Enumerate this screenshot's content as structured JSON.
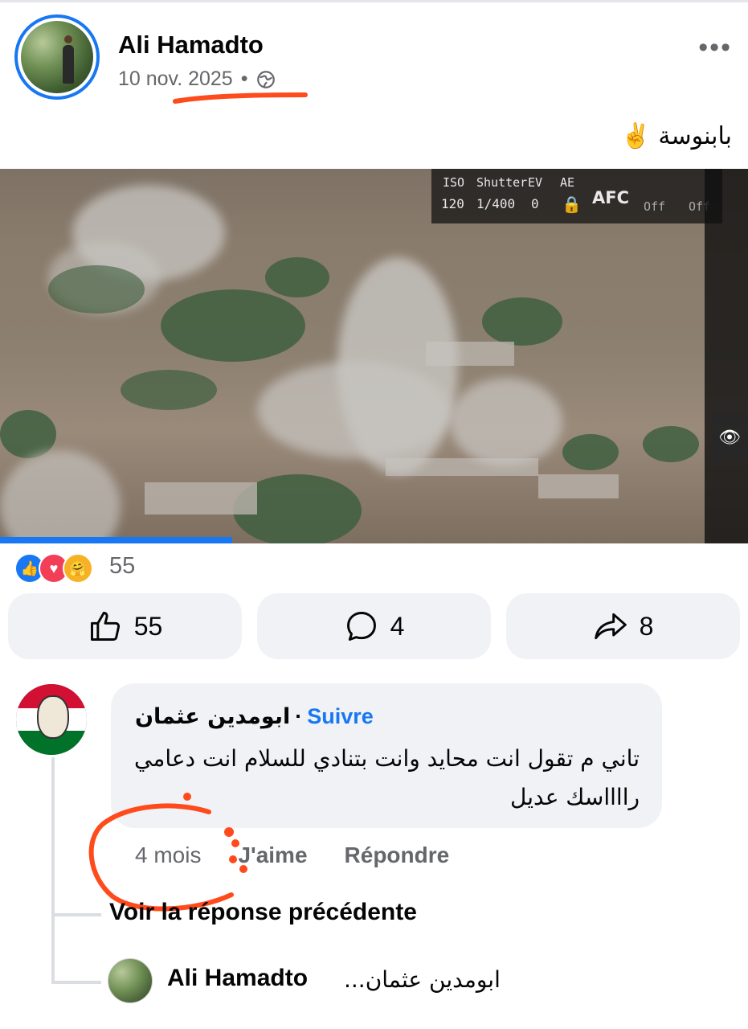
{
  "post": {
    "author": "Ali Hamadto",
    "date": "10 nov. 2025",
    "separator": "•",
    "privacy_icon": "globe-icon",
    "more_icon": "more-options-icon",
    "caption": "بابنوسة ✌️"
  },
  "video": {
    "hud": {
      "iso_label": "ISO",
      "iso_value": "120",
      "shutter_label": "Shutter",
      "shutter_value": "1/400",
      "ev_label": "EV",
      "ev_value": "0",
      "ae_label": "AE",
      "mode": "AFC",
      "off1": "Off",
      "off2": "Off"
    },
    "progress": 0.31
  },
  "reactions": {
    "icons": [
      "like",
      "love",
      "care"
    ],
    "count": "55"
  },
  "actions": {
    "like_count": "55",
    "comment_count": "4",
    "share_count": "8"
  },
  "comment": {
    "author": "ابومدين عثمان",
    "dot": "·",
    "follow": "Suivre",
    "text": "تاني م تقول انت محايد وانت بتنادي للسلام انت دعامي رااااسك عديل",
    "time": "4 mois",
    "like": "J'aime",
    "reply": "Répondre"
  },
  "previous_reply": "Voir la réponse précédente",
  "reply": {
    "author": "Ali Hamadto",
    "snippet": "ابومدين عثمان..."
  },
  "colors": {
    "accent": "#1877f2",
    "annotation": "#ff4a1c",
    "button_bg": "#f0f2f5",
    "muted_text": "#65676b"
  }
}
